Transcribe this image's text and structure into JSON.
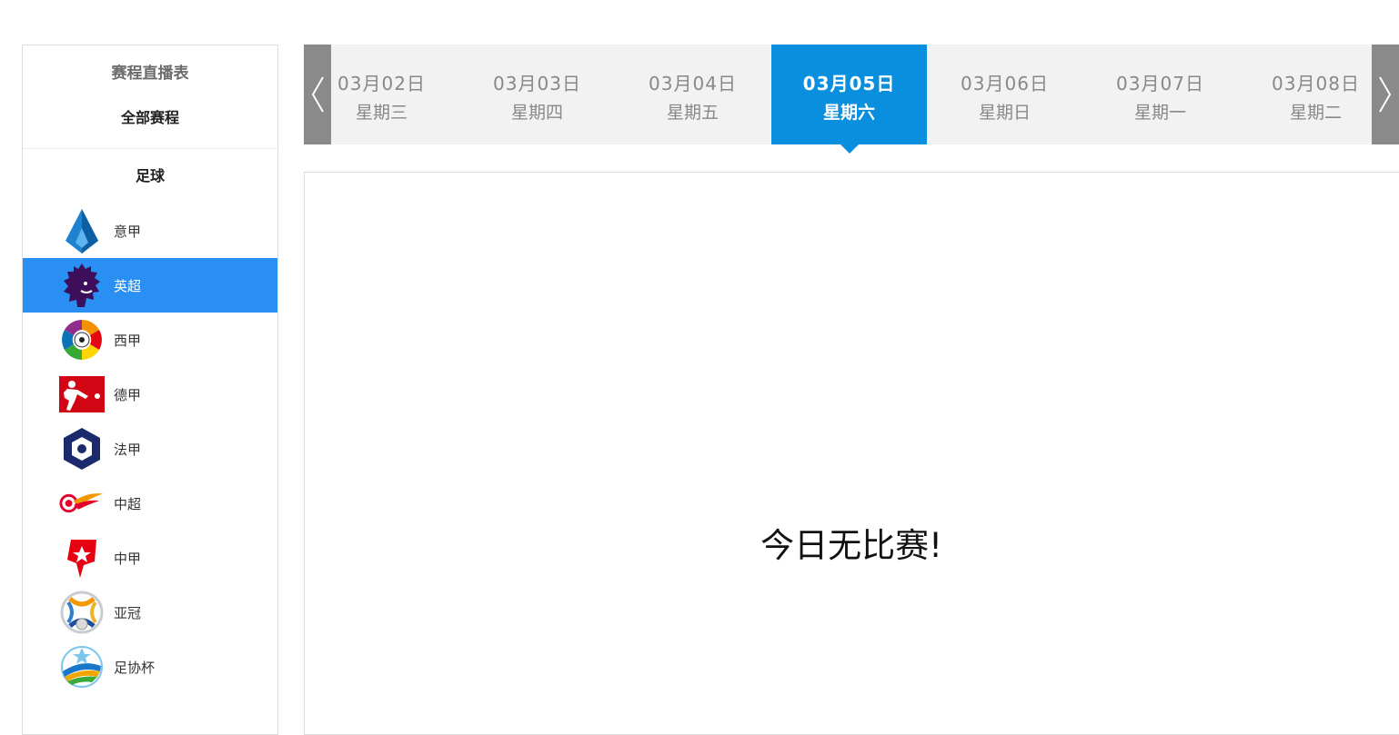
{
  "sidebar": {
    "title": "赛程直播表",
    "all": "全部赛程",
    "section": "足球",
    "items": [
      {
        "label": "意甲",
        "icon": "serie-a-logo-icon"
      },
      {
        "label": "英超",
        "icon": "premier-league-lion-icon",
        "active": true
      },
      {
        "label": "西甲",
        "icon": "laliga-logo-icon"
      },
      {
        "label": "德甲",
        "icon": "bundesliga-logo-icon"
      },
      {
        "label": "法甲",
        "icon": "ligue1-logo-icon"
      },
      {
        "label": "中超",
        "icon": "csl-logo-icon"
      },
      {
        "label": "中甲",
        "icon": "china-league-one-logo-icon"
      },
      {
        "label": "亚冠",
        "icon": "afc-champions-league-logo-icon"
      },
      {
        "label": "足协杯",
        "icon": "fa-cup-logo-icon"
      }
    ]
  },
  "dates": [
    {
      "date": "03月02日",
      "weekday": "星期三"
    },
    {
      "date": "03月03日",
      "weekday": "星期四"
    },
    {
      "date": "03月04日",
      "weekday": "星期五"
    },
    {
      "date": "03月05日",
      "weekday": "星期六",
      "active": true
    },
    {
      "date": "03月06日",
      "weekday": "星期日"
    },
    {
      "date": "03月07日",
      "weekday": "星期一"
    },
    {
      "date": "03月08日",
      "weekday": "星期二"
    }
  ],
  "arrows": {
    "left": "chevron-left-icon",
    "right": "chevron-right-icon"
  },
  "main": {
    "empty_message": "今日无比赛!"
  },
  "colors": {
    "active_date": "#0a8fdf",
    "active_item": "#2a8ff2",
    "arrow_bg": "#8a8a8a",
    "datebar_bg": "#f2f2f2"
  }
}
